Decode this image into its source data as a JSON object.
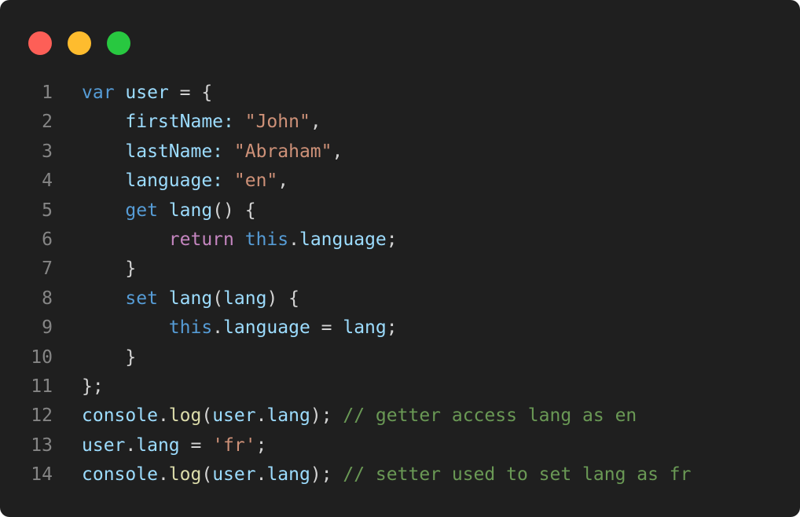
{
  "window": {
    "traffic_lights": [
      {
        "name": "close",
        "color": "#fd5f57"
      },
      {
        "name": "minimize",
        "color": "#febc2e"
      },
      {
        "name": "zoom",
        "color": "#28c840"
      }
    ]
  },
  "colors": {
    "background": "#1f1f1f",
    "line_number": "#858585",
    "keyword": "#569cd6",
    "variable": "#9cdcfe",
    "string": "#ce9178",
    "function": "#dcdcaa",
    "control": "#c586c0",
    "comment": "#6a9955",
    "punctuation": "#d4d4d4"
  },
  "code": {
    "lines": [
      {
        "number": "1",
        "tokens": [
          {
            "text": "var",
            "kind": "keyword"
          },
          {
            "text": " ",
            "kind": "punctuation"
          },
          {
            "text": "user",
            "kind": "variable"
          },
          {
            "text": " = {",
            "kind": "punctuation"
          }
        ]
      },
      {
        "number": "2",
        "tokens": [
          {
            "text": "    ",
            "kind": "punctuation"
          },
          {
            "text": "firstName",
            "kind": "variable"
          },
          {
            "text": ": ",
            "kind": "variable"
          },
          {
            "text": "\"John\"",
            "kind": "string"
          },
          {
            "text": ",",
            "kind": "punctuation"
          }
        ]
      },
      {
        "number": "3",
        "tokens": [
          {
            "text": "    ",
            "kind": "punctuation"
          },
          {
            "text": "lastName",
            "kind": "variable"
          },
          {
            "text": ": ",
            "kind": "variable"
          },
          {
            "text": "\"Abraham\"",
            "kind": "string"
          },
          {
            "text": ",",
            "kind": "punctuation"
          }
        ]
      },
      {
        "number": "4",
        "tokens": [
          {
            "text": "    ",
            "kind": "punctuation"
          },
          {
            "text": "language",
            "kind": "variable"
          },
          {
            "text": ": ",
            "kind": "variable"
          },
          {
            "text": "\"en\"",
            "kind": "string"
          },
          {
            "text": ",",
            "kind": "punctuation"
          }
        ]
      },
      {
        "number": "5",
        "tokens": [
          {
            "text": "    ",
            "kind": "punctuation"
          },
          {
            "text": "get",
            "kind": "keyword"
          },
          {
            "text": " ",
            "kind": "punctuation"
          },
          {
            "text": "lang",
            "kind": "variable"
          },
          {
            "text": "() {",
            "kind": "punctuation"
          }
        ]
      },
      {
        "number": "6",
        "tokens": [
          {
            "text": "        ",
            "kind": "punctuation"
          },
          {
            "text": "return",
            "kind": "control"
          },
          {
            "text": " ",
            "kind": "punctuation"
          },
          {
            "text": "this",
            "kind": "keyword"
          },
          {
            "text": ".",
            "kind": "punctuation"
          },
          {
            "text": "language",
            "kind": "variable"
          },
          {
            "text": ";",
            "kind": "punctuation"
          }
        ]
      },
      {
        "number": "7",
        "tokens": [
          {
            "text": "    }",
            "kind": "punctuation"
          }
        ]
      },
      {
        "number": "8",
        "tokens": [
          {
            "text": "    ",
            "kind": "punctuation"
          },
          {
            "text": "set",
            "kind": "keyword"
          },
          {
            "text": " ",
            "kind": "punctuation"
          },
          {
            "text": "lang",
            "kind": "variable"
          },
          {
            "text": "(",
            "kind": "punctuation"
          },
          {
            "text": "lang",
            "kind": "variable"
          },
          {
            "text": ") {",
            "kind": "punctuation"
          }
        ]
      },
      {
        "number": "9",
        "tokens": [
          {
            "text": "        ",
            "kind": "punctuation"
          },
          {
            "text": "this",
            "kind": "keyword"
          },
          {
            "text": ".",
            "kind": "punctuation"
          },
          {
            "text": "language",
            "kind": "variable"
          },
          {
            "text": " = ",
            "kind": "punctuation"
          },
          {
            "text": "lang",
            "kind": "variable"
          },
          {
            "text": ";",
            "kind": "punctuation"
          }
        ]
      },
      {
        "number": "10",
        "tokens": [
          {
            "text": "    }",
            "kind": "punctuation"
          }
        ]
      },
      {
        "number": "11",
        "tokens": [
          {
            "text": "};",
            "kind": "punctuation"
          }
        ]
      },
      {
        "number": "12",
        "tokens": [
          {
            "text": "console",
            "kind": "variable"
          },
          {
            "text": ".",
            "kind": "punctuation"
          },
          {
            "text": "log",
            "kind": "function"
          },
          {
            "text": "(",
            "kind": "punctuation"
          },
          {
            "text": "user",
            "kind": "variable"
          },
          {
            "text": ".",
            "kind": "punctuation"
          },
          {
            "text": "lang",
            "kind": "variable"
          },
          {
            "text": "); ",
            "kind": "punctuation"
          },
          {
            "text": "// getter access lang as en",
            "kind": "comment"
          }
        ]
      },
      {
        "number": "13",
        "tokens": [
          {
            "text": "user",
            "kind": "variable"
          },
          {
            "text": ".",
            "kind": "punctuation"
          },
          {
            "text": "lang",
            "kind": "variable"
          },
          {
            "text": " = ",
            "kind": "punctuation"
          },
          {
            "text": "'fr'",
            "kind": "string"
          },
          {
            "text": ";",
            "kind": "punctuation"
          }
        ]
      },
      {
        "number": "14",
        "tokens": [
          {
            "text": "console",
            "kind": "variable"
          },
          {
            "text": ".",
            "kind": "punctuation"
          },
          {
            "text": "log",
            "kind": "function"
          },
          {
            "text": "(",
            "kind": "punctuation"
          },
          {
            "text": "user",
            "kind": "variable"
          },
          {
            "text": ".",
            "kind": "punctuation"
          },
          {
            "text": "lang",
            "kind": "variable"
          },
          {
            "text": "); ",
            "kind": "punctuation"
          },
          {
            "text": "// setter used to set lang as fr",
            "kind": "comment"
          }
        ]
      }
    ]
  }
}
